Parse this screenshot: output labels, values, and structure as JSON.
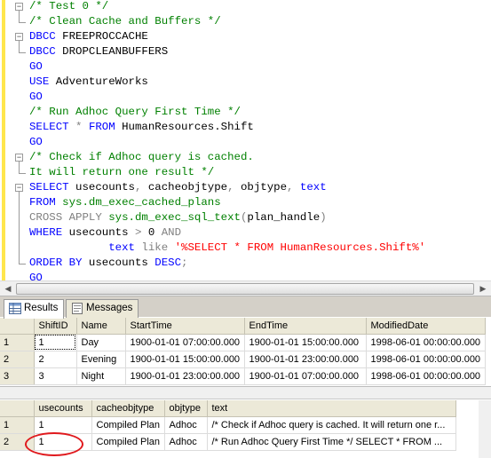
{
  "editor": {
    "lines": [
      [
        {
          "t": "/* Test 0 */",
          "c": "cm"
        }
      ],
      [
        {
          "t": "/* Clean Cache and Buffers */",
          "c": "cm"
        }
      ],
      [
        {
          "t": "DBCC",
          "c": "kw"
        },
        {
          "t": " FREEPROCCACHE",
          "c": "pl"
        }
      ],
      [
        {
          "t": "DBCC",
          "c": "kw"
        },
        {
          "t": " DROPCLEANBUFFERS",
          "c": "pl"
        }
      ],
      [
        {
          "t": "GO",
          "c": "kw"
        }
      ],
      [
        {
          "t": "USE",
          "c": "kw"
        },
        {
          "t": " AdventureWorks",
          "c": "pl"
        }
      ],
      [
        {
          "t": "GO",
          "c": "kw"
        }
      ],
      [
        {
          "t": "/* Run Adhoc Query First Time */",
          "c": "cm"
        }
      ],
      [
        {
          "t": "SELECT",
          "c": "kw"
        },
        {
          "t": " * ",
          "c": "gr"
        },
        {
          "t": "FROM",
          "c": "kw"
        },
        {
          "t": " HumanResources.Shift",
          "c": "pl"
        }
      ],
      [
        {
          "t": "GO",
          "c": "kw"
        }
      ],
      [
        {
          "t": "/* Check if Adhoc query is cached.",
          "c": "cm"
        }
      ],
      [
        {
          "t": "It will return one result */",
          "c": "cm"
        }
      ],
      [
        {
          "t": "SELECT",
          "c": "kw"
        },
        {
          "t": " usecounts",
          "c": "pl"
        },
        {
          "t": ",",
          "c": "gr"
        },
        {
          "t": " cacheobjtype",
          "c": "pl"
        },
        {
          "t": ",",
          "c": "gr"
        },
        {
          "t": " objtype",
          "c": "pl"
        },
        {
          "t": ",",
          "c": "gr"
        },
        {
          "t": " ",
          "c": "pl"
        },
        {
          "t": "text",
          "c": "kw"
        }
      ],
      [
        {
          "t": "FROM",
          "c": "kw"
        },
        {
          "t": " sys.dm_exec_cached_plans",
          "c": "sy"
        }
      ],
      [
        {
          "t": "CROSS APPLY",
          "c": "gr"
        },
        {
          "t": " sys.dm_exec_sql_text",
          "c": "sy"
        },
        {
          "t": "(",
          "c": "gr"
        },
        {
          "t": "plan_handle",
          "c": "pl"
        },
        {
          "t": ")",
          "c": "gr"
        }
      ],
      [
        {
          "t": "WHERE",
          "c": "kw"
        },
        {
          "t": " usecounts ",
          "c": "pl"
        },
        {
          "t": ">",
          "c": "gr"
        },
        {
          "t": " 0 ",
          "c": "pl"
        },
        {
          "t": "AND",
          "c": "gr"
        }
      ],
      [
        {
          "t": "            text ",
          "c": "kw"
        },
        {
          "t": "like",
          "c": "gr"
        },
        {
          "t": " '%SELECT * FROM HumanResources.Shift%'",
          "c": "st"
        }
      ],
      [
        {
          "t": "ORDER BY",
          "c": "kw"
        },
        {
          "t": " usecounts ",
          "c": "pl"
        },
        {
          "t": "DESC",
          "c": "kw"
        },
        {
          "t": ";",
          "c": "gr"
        }
      ],
      [
        {
          "t": "GO",
          "c": "kw"
        }
      ]
    ]
  },
  "tabs": [
    {
      "label": "Results",
      "active": true,
      "icon": "grid-icon"
    },
    {
      "label": "Messages",
      "active": false,
      "icon": "messages-icon"
    }
  ],
  "grid1": {
    "columns": [
      "ShiftID",
      "Name",
      "StartTime",
      "EndTime",
      "ModifiedDate"
    ],
    "rows": [
      [
        "1",
        "1",
        "Day",
        "1900-01-01 07:00:00.000",
        "1900-01-01 15:00:00.000",
        "1998-06-01 00:00:00.000"
      ],
      [
        "2",
        "2",
        "Evening",
        "1900-01-01 15:00:00.000",
        "1900-01-01 23:00:00.000",
        "1998-06-01 00:00:00.000"
      ],
      [
        "3",
        "3",
        "Night",
        "1900-01-01 23:00:00.000",
        "1900-01-01 07:00:00.000",
        "1998-06-01 00:00:00.000"
      ]
    ]
  },
  "grid2": {
    "columns": [
      "usecounts",
      "cacheobjtype",
      "objtype",
      "text"
    ],
    "rows": [
      [
        "1",
        "1",
        "Compiled Plan",
        "Adhoc",
        "/* Check if Adhoc query is cached.  It will return one r..."
      ],
      [
        "2",
        "1",
        "Compiled Plan",
        "Adhoc",
        "/* Run Adhoc Query First Time */  SELECT * FROM ..."
      ]
    ]
  },
  "colors": {
    "keyword": "#0000ff",
    "comment": "#008000",
    "string": "#ff0000",
    "annotation_circle": "#e0191d"
  }
}
